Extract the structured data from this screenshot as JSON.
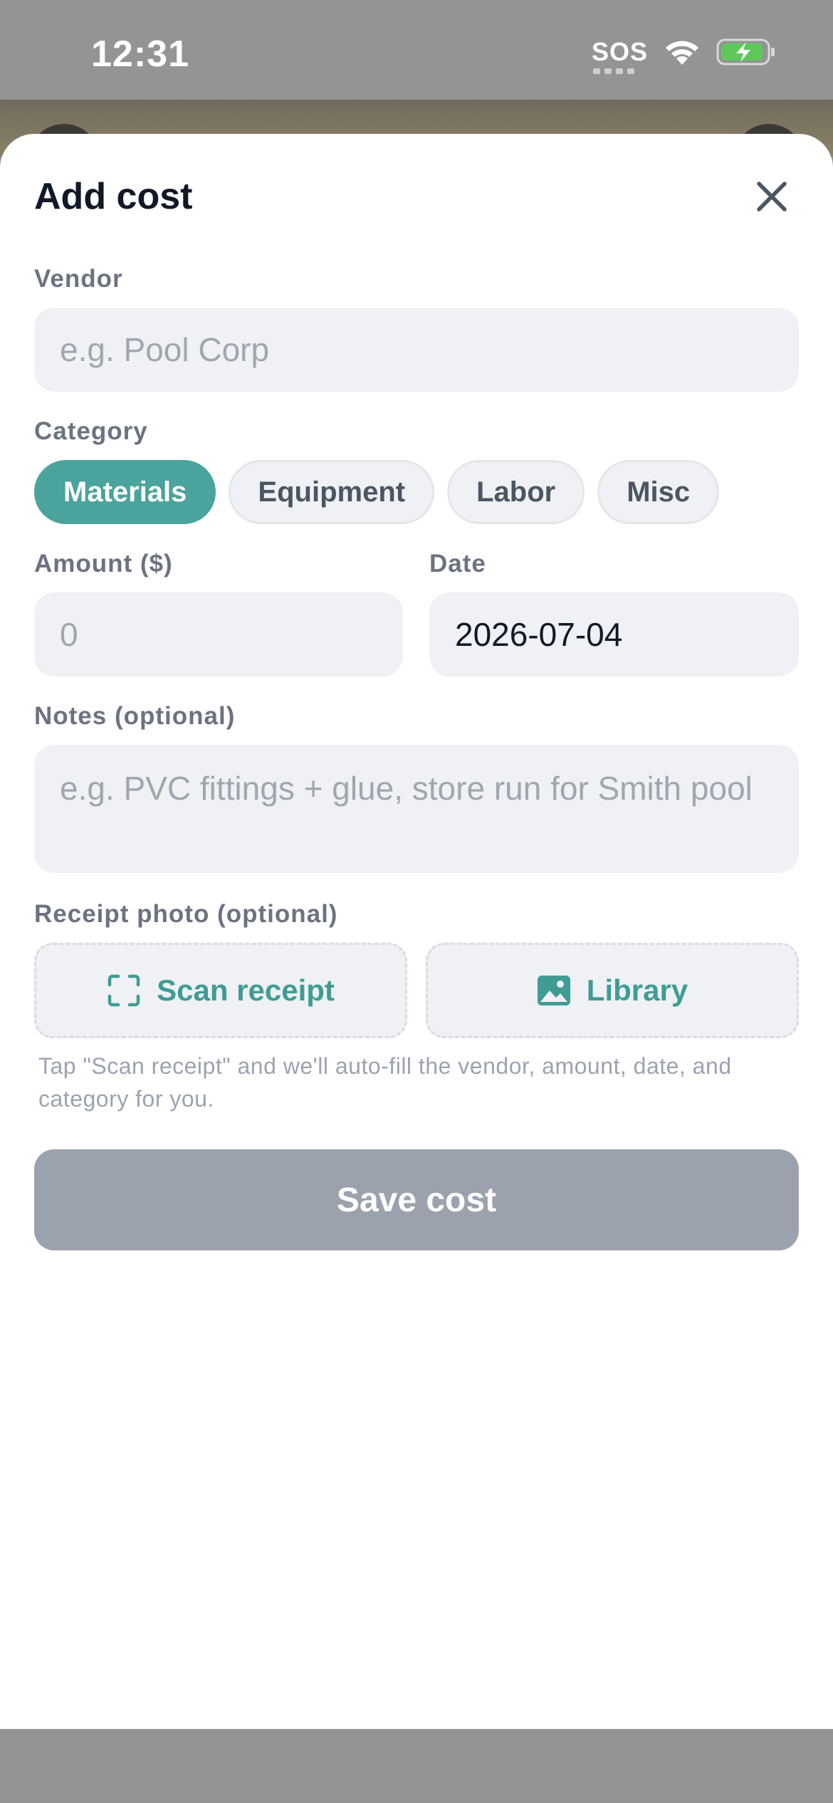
{
  "status_bar": {
    "time": "12:31",
    "sos": "SOS",
    "icons": [
      "wifi-icon",
      "battery-charging-icon"
    ]
  },
  "sheet": {
    "title": "Add cost",
    "close_icon": "close-icon"
  },
  "vendor": {
    "label": "Vendor",
    "value": "",
    "placeholder": "e.g. Pool Corp"
  },
  "category": {
    "label": "Category",
    "options": [
      "Materials",
      "Equipment",
      "Labor",
      "Misc"
    ],
    "selected": "Materials"
  },
  "amount": {
    "label": "Amount ($)",
    "value": "",
    "placeholder": "0"
  },
  "date": {
    "label": "Date",
    "value": "2026-07-04"
  },
  "notes": {
    "label": "Notes (optional)",
    "value": "",
    "placeholder": "e.g. PVC fittings + glue, store run for Smith pool"
  },
  "receipt": {
    "label": "Receipt photo (optional)",
    "scan_label": "Scan receipt",
    "scan_icon": "scan-icon",
    "library_label": "Library",
    "library_icon": "image-icon",
    "hint": "Tap \"Scan receipt\" and we'll auto-fill the vendor, amount, date, and category for you."
  },
  "save": {
    "label": "Save cost"
  },
  "colors": {
    "accent": "#4aa39c",
    "save_disabled": "#9ca2ad",
    "input_bg": "#eff1f4"
  }
}
